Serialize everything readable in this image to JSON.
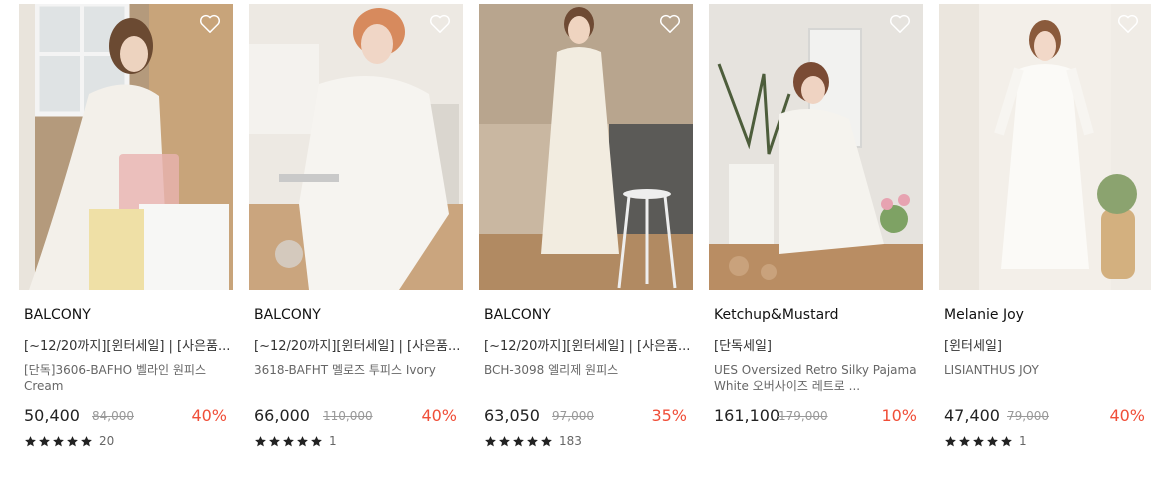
{
  "products": [
    {
      "brand": "BALCONY",
      "tag": "[~12/20까지][윈터세일] | [사은품...",
      "name": "[단독]3606-BAFHO 벨라인 원피스 Cream",
      "price": "50,400",
      "original_price": "84,000",
      "discount": "40%",
      "rating_count": "20",
      "image_description": "model-in-white-dress-near-window",
      "wishlist_icon": "heart-outline-icon"
    },
    {
      "brand": "BALCONY",
      "tag": "[~12/20까지][윈터세일] | [사은품...",
      "name": "3618-BAFHT 멜로즈 투피스 Ivory",
      "price": "66,000",
      "original_price": "110,000",
      "discount": "40%",
      "rating_count": "1",
      "image_description": "model-in-white-two-piece-on-chair",
      "wishlist_icon": "heart-outline-icon"
    },
    {
      "brand": "BALCONY",
      "tag": "[~12/20까지][윈터세일] | [사은품...",
      "name": "BCH-3098 엘리제 원피스",
      "price": "63,050",
      "original_price": "97,000",
      "discount": "35%",
      "rating_count": "183",
      "image_description": "model-in-white-long-dress-by-stool",
      "wishlist_icon": "heart-outline-icon"
    },
    {
      "brand": "Ketchup&Mustard",
      "tag": "[단독세일]",
      "name": "UES Oversized Retro Silky Pajama White 오버사이즈 레트로 ...",
      "price": "161,100",
      "original_price": "179,000",
      "discount": "10%",
      "rating_count": "",
      "image_description": "model-in-white-pajama-with-flowers",
      "wishlist_icon": "heart-outline-icon"
    },
    {
      "brand": "Melanie Joy",
      "tag": "[윈터세일]",
      "name": "LISIANTHUS JOY",
      "price": "47,400",
      "original_price": "79,000",
      "discount": "40%",
      "rating_count": "1",
      "image_description": "model-in-white-nightgown-with-plant",
      "wishlist_icon": "heart-outline-icon"
    }
  ],
  "colors": {
    "discount": "#f04e38",
    "star": "#222222"
  }
}
